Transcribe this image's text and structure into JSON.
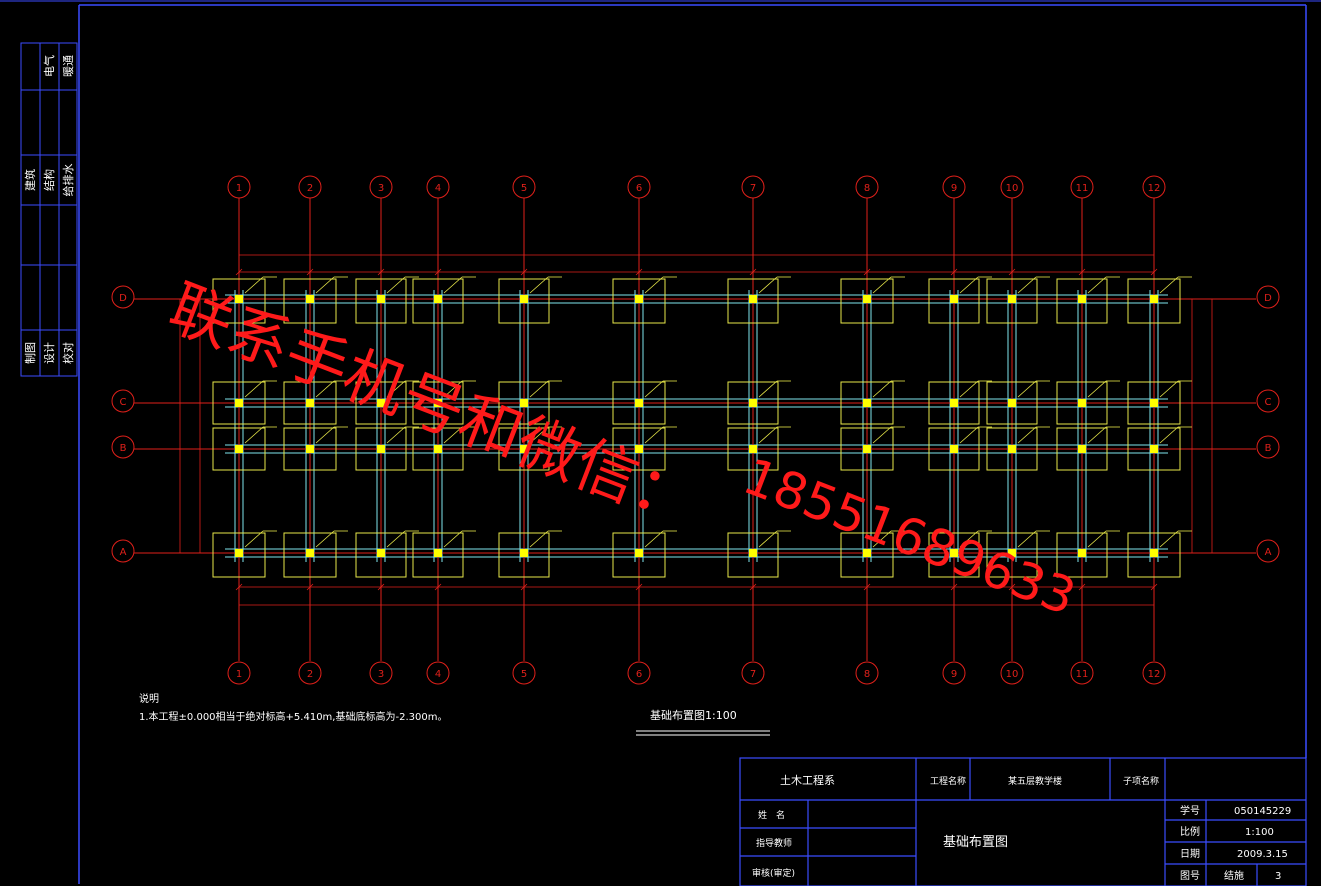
{
  "colors": {
    "background": "#000000",
    "border": "#3b4cff",
    "axis": "#e0201a",
    "beam": "#7fe6ee",
    "footing": "#e8e84a",
    "column": "#ffff00",
    "text": "#ffffff",
    "watermark": "#ff1a1a",
    "label_small": "#d8d84a"
  },
  "left_strip": {
    "group1": [
      "电气",
      "暖通"
    ],
    "group2": [
      "建筑",
      "结构",
      "给排水"
    ],
    "group3": [
      "制图",
      "设计",
      "校对"
    ]
  },
  "grid_columns": [
    "1",
    "2",
    "3",
    "4",
    "5",
    "6",
    "7",
    "8",
    "9",
    "10",
    "11",
    "12"
  ],
  "grid_rows": [
    "D",
    "C",
    "B",
    "A"
  ],
  "notes": {
    "heading": "说明",
    "line1": "1.本工程±0.000相当于绝对标高+5.410m,基础底标高为-2.300m。"
  },
  "drawing_title": "基础布置图1:100",
  "watermark": {
    "line1": "联系手机号和微信：",
    "line2": "18551689633"
  },
  "title_block": {
    "dept": "土木工程系",
    "project_label": "工程名称",
    "project_value": "某五层教学楼",
    "drawing_name_label": "子项名称",
    "name_label": "姓　名",
    "advisor_label": "指导教师",
    "review_label": "审核(审定)",
    "drawing_title": "基础布置图",
    "student_id_label": "学号",
    "student_id_value": "050145229",
    "scale_label": "比例",
    "scale_value": "1:100",
    "date_label": "日期",
    "date_value": "2009.3.15",
    "sheet_label": "图号",
    "sheet_type": "结施",
    "sheet_no": "3"
  }
}
